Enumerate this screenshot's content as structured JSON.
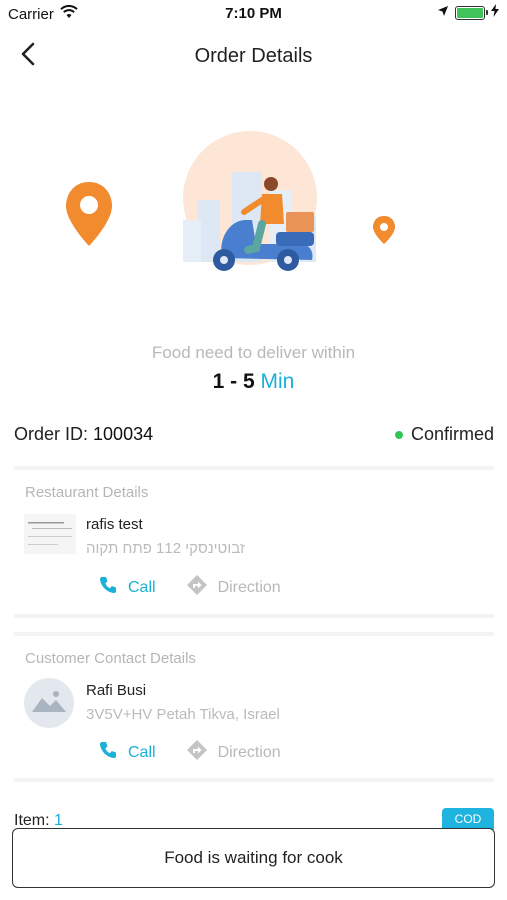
{
  "status_bar": {
    "carrier": "Carrier",
    "time": "7:10 PM",
    "battery_level": 1.0,
    "battery_color": "#3fc35a",
    "icons": [
      "wifi-icon",
      "location-arrow-icon",
      "battery-icon",
      "charging-bolt-icon"
    ]
  },
  "nav": {
    "title": "Order Details",
    "back_icon": "chevron-left-icon"
  },
  "illustration": {
    "icons": [
      "map-pin-icon",
      "delivery-scooter-icon",
      "map-pin-icon"
    ],
    "accent": "#f28a2e"
  },
  "delivery": {
    "label": "Food need to deliver within",
    "range": "1 - 5",
    "unit": "Min"
  },
  "order": {
    "id_label": "Order ID:",
    "id_value": "100034",
    "status": "Confirmed",
    "status_color": "#34c55a"
  },
  "restaurant": {
    "section_title": "Restaurant Details",
    "name": "rafis test",
    "address": "זבוטינסקי 112 פתח תקוה",
    "call_label": "Call",
    "direction_label": "Direction"
  },
  "customer": {
    "section_title": "Customer Contact Details",
    "name": "Rafi Busi",
    "address": "3V5V+HV Petah Tikva, Israel",
    "call_label": "Call",
    "direction_label": "Direction"
  },
  "items": {
    "label": "Item:",
    "count": "1",
    "payment_badge": "COD"
  },
  "footer": {
    "button_label": "Food is waiting for cook"
  },
  "colors": {
    "accent": "#1bb0d8",
    "muted": "#b8b8b8"
  }
}
